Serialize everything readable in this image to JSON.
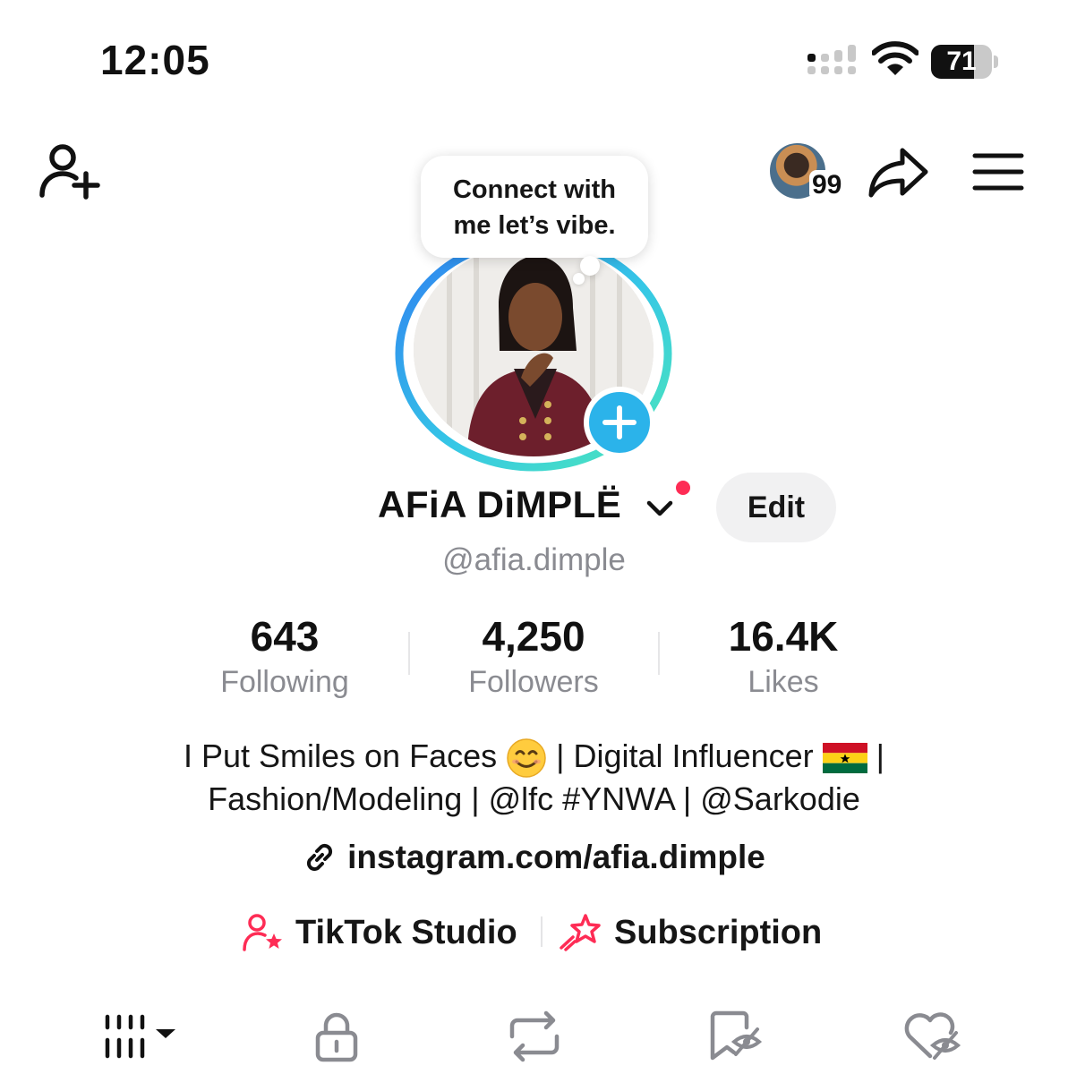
{
  "status_bar": {
    "time": "12:05",
    "battery": "71",
    "battery_level": 0.71
  },
  "header": {
    "story_count": "99"
  },
  "profile": {
    "note": [
      "Connect with",
      "me let’s vibe."
    ],
    "display_name": "AFiA DiMPLË",
    "edit_label": "Edit",
    "handle": "@afia.dimple",
    "stats": [
      {
        "value": "643",
        "label": "Following"
      },
      {
        "value": "4,250",
        "label": "Followers"
      },
      {
        "value": "16.4K",
        "label": "Likes"
      }
    ],
    "bio_line1_a": "I Put Smiles on Faces",
    "bio_line1_b": "| Digital Influencer",
    "bio_line1_c": "|",
    "bio_line2": "Fashion/Modeling | @lfc #YNWA | @Sarkodie",
    "link": "instagram.com/afia.dimple",
    "studio_label": "TikTok Studio",
    "subscription_label": "Subscription"
  },
  "colors": {
    "accent_red": "#fe2c55",
    "add_blue": "#2bb3ea",
    "secondary_text": "#8a8b91"
  },
  "icons": [
    "add-friend-icon",
    "share-icon",
    "menu-icon",
    "chevron-down-icon",
    "link-icon",
    "studio-icon",
    "subscription-icon",
    "videos-grid-icon",
    "lock-icon",
    "repost-icon",
    "favorites-icon",
    "liked-icon"
  ]
}
